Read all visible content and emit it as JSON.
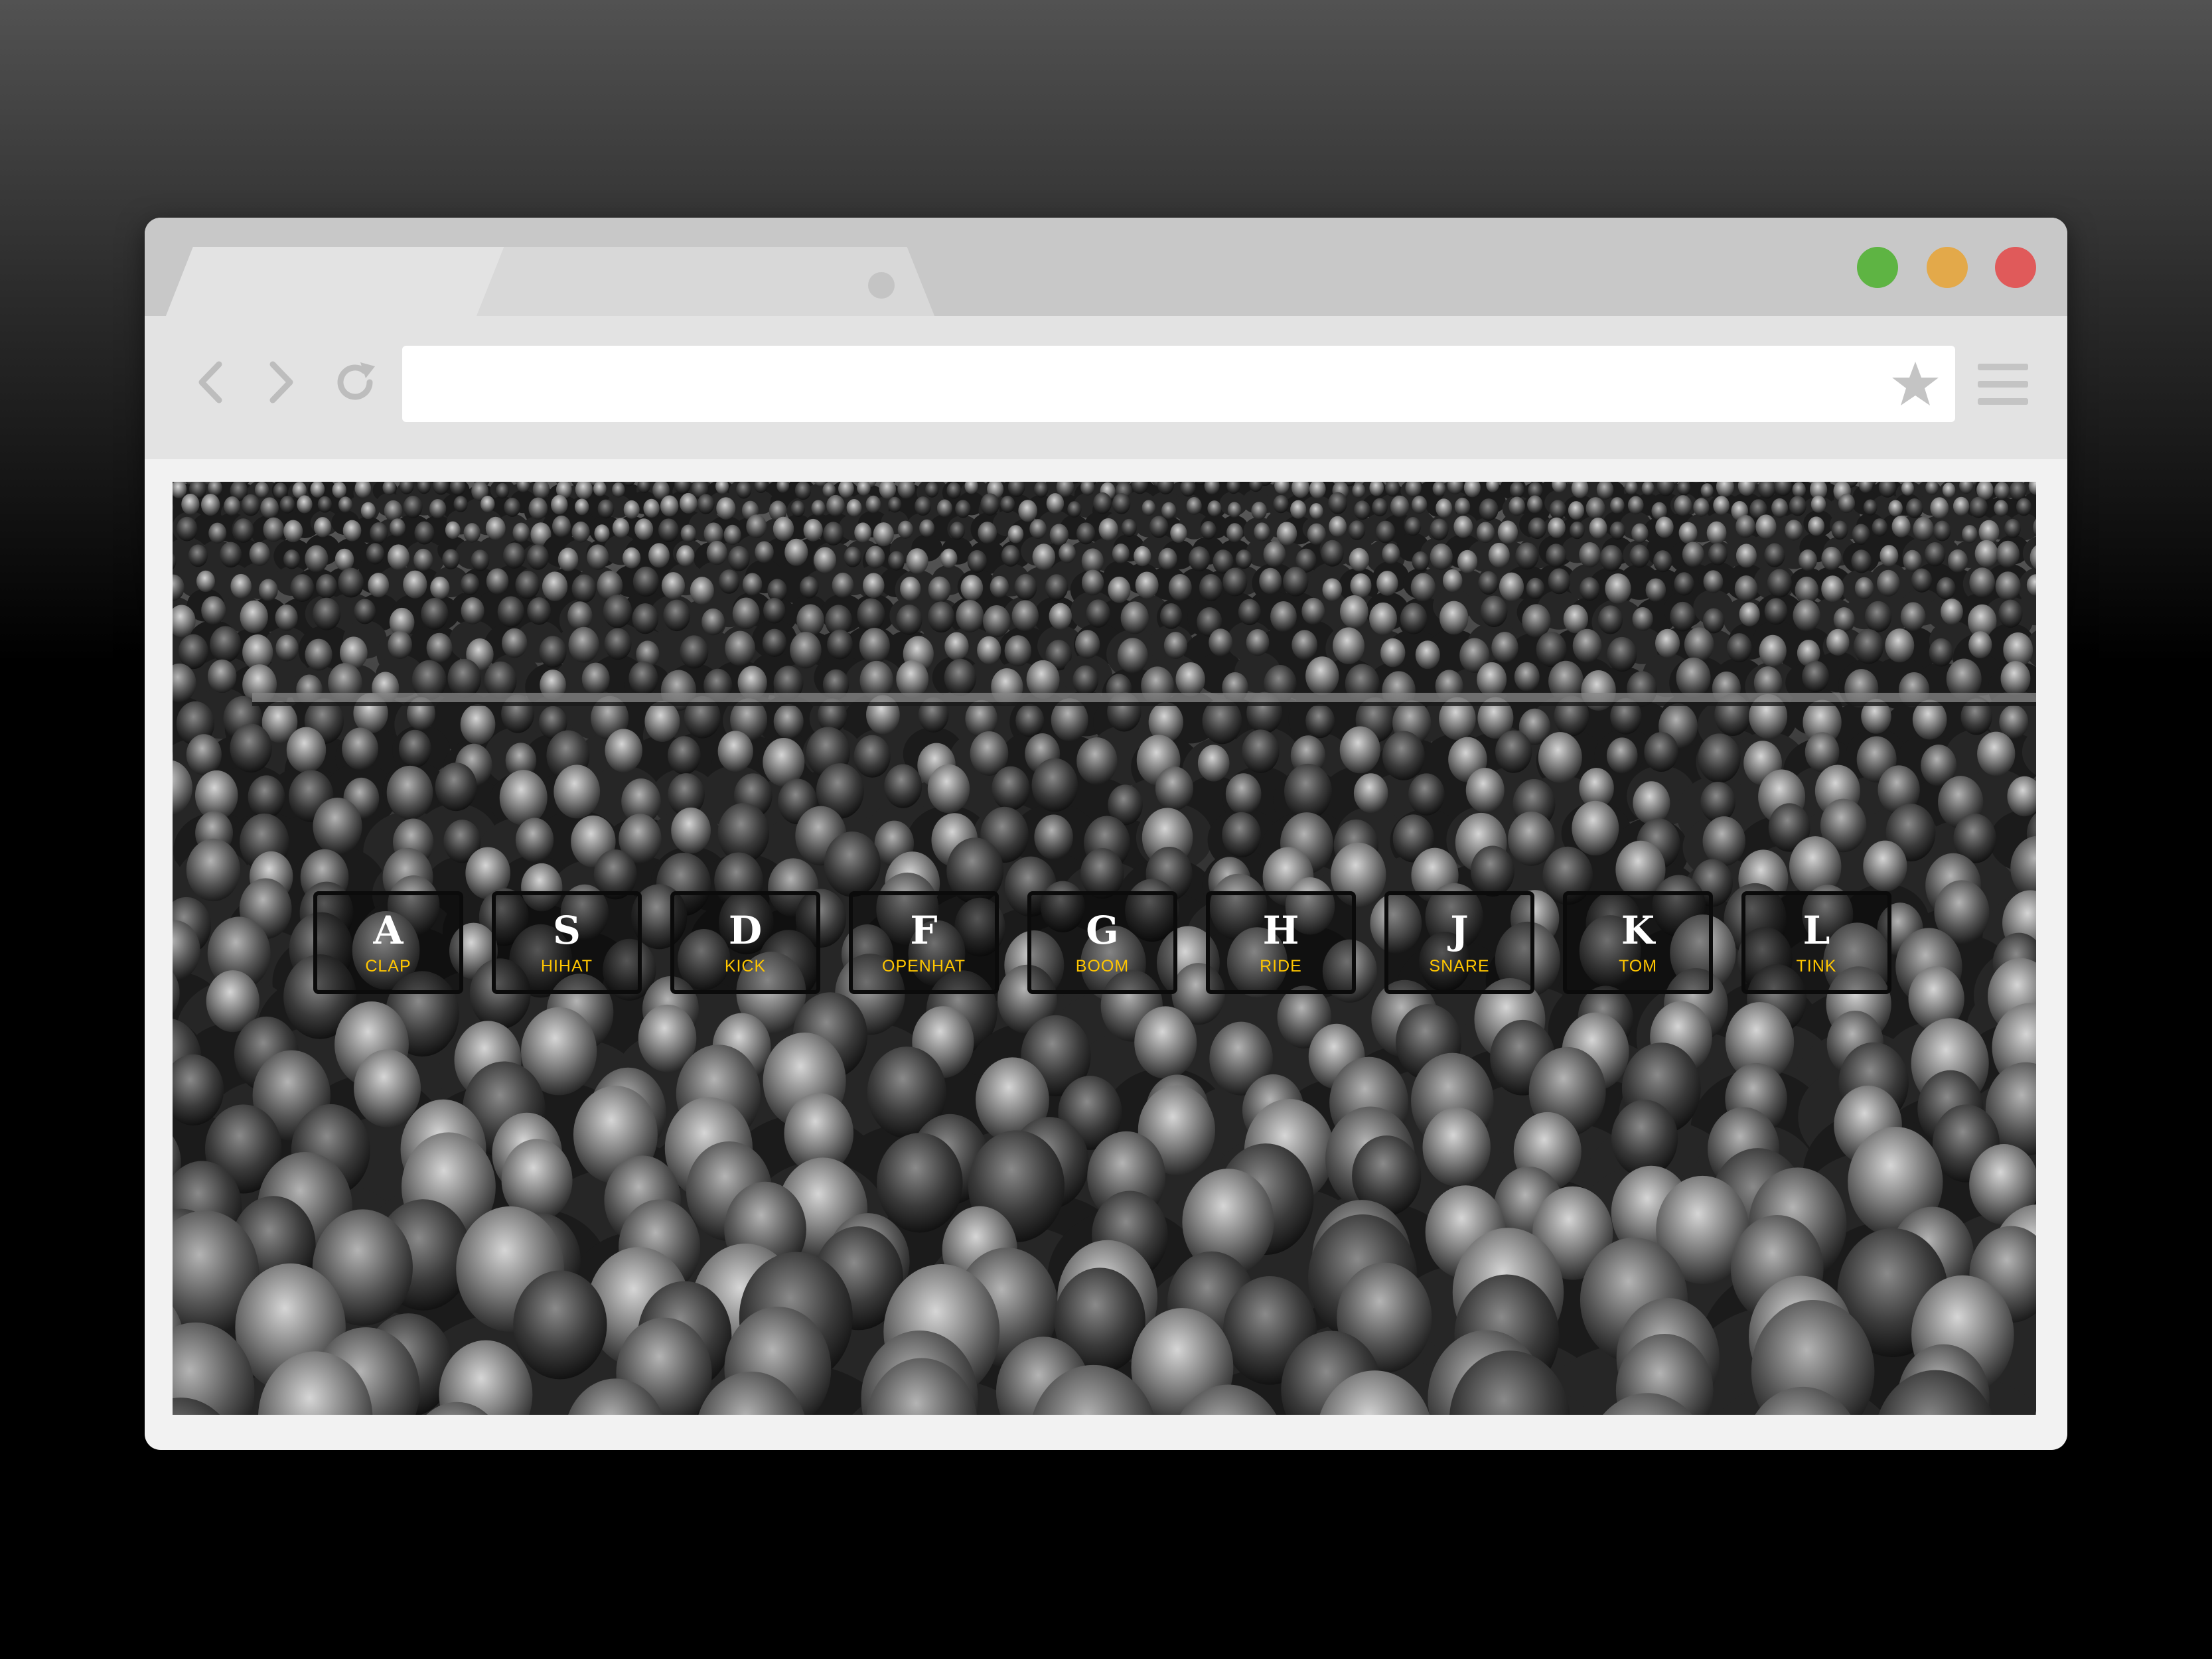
{
  "browser": {
    "tabs": [
      {
        "label": ""
      },
      {
        "label": ""
      }
    ],
    "address_bar": {
      "value": ""
    },
    "window_controls": [
      "green",
      "yellow",
      "red"
    ],
    "icons": [
      "back-icon",
      "forward-icon",
      "reload-icon",
      "star-icon",
      "menu-icon"
    ]
  },
  "drum_kit": {
    "keys": [
      {
        "key": "A",
        "sound": "CLAP"
      },
      {
        "key": "S",
        "sound": "HIHAT"
      },
      {
        "key": "D",
        "sound": "KICK"
      },
      {
        "key": "F",
        "sound": "OPENHAT"
      },
      {
        "key": "G",
        "sound": "BOOM"
      },
      {
        "key": "H",
        "sound": "RIDE"
      },
      {
        "key": "J",
        "sound": "SNARE"
      },
      {
        "key": "K",
        "sound": "TOM"
      },
      {
        "key": "L",
        "sound": "TINK"
      }
    ]
  },
  "colors": {
    "accent": "#ffc600",
    "key_text": "#ffffff",
    "key_border": "#0b0b0b",
    "traffic_green": "#5eb443",
    "traffic_yellow": "#e3a94a",
    "traffic_red": "#e05a5a"
  }
}
